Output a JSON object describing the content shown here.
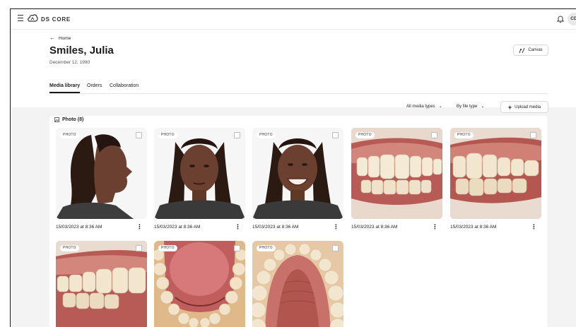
{
  "app": {
    "brand": "DS CORE",
    "user_initials": "CD"
  },
  "header": {
    "back_label": "Home",
    "patient_name": "Smiles, Julia",
    "dob": "December 12, 1990",
    "canvas_label": "Canvas"
  },
  "tabs": [
    {
      "label": "Media library",
      "active": true
    },
    {
      "label": "Orders",
      "active": false
    },
    {
      "label": "Collaboration",
      "active": false
    }
  ],
  "filters": {
    "media_types": "All media types",
    "file_type": "By file type",
    "upload_label": "Upload media"
  },
  "section": {
    "title": "Photo (8)"
  },
  "photos": [
    {
      "badge": "PHOTO",
      "date": "15/03/2023 at 8:36 AM",
      "kind": "profile-face"
    },
    {
      "badge": "PHOTO",
      "date": "15/03/2023 at 8:36 AM",
      "kind": "frontal-face"
    },
    {
      "badge": "PHOTO",
      "date": "15/03/2023 at 8:36 AM",
      "kind": "smiling-face"
    },
    {
      "badge": "PHOTO",
      "date": "15/03/2023 at 8:36 AM",
      "kind": "intraoral-frontal"
    },
    {
      "badge": "PHOTO",
      "date": "15/03/2023 at 8:36 AM",
      "kind": "intraoral-lateral"
    },
    {
      "badge": "PHOTO",
      "date": "",
      "kind": "intraoral-lateral"
    },
    {
      "badge": "PHOTO",
      "date": "",
      "kind": "occlusal-lower"
    },
    {
      "badge": "PHOTO",
      "date": "",
      "kind": "occlusal-upper"
    }
  ],
  "colors": {
    "accent": "#1c1c1c",
    "background": "#f3f3f3",
    "gum": "#c9726a",
    "tooth": "#f4ead6",
    "skin": "#6b4030"
  }
}
